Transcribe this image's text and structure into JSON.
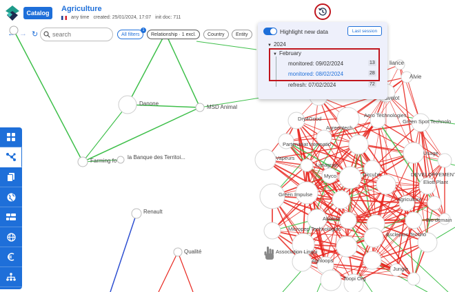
{
  "header": {
    "catalog_label": "Catalog",
    "title": "Agriculture",
    "period": "any time",
    "created": "created: 25/01/2024, 17:07",
    "init_doc": "init doc: 711"
  },
  "toolbar": {
    "search_placeholder": "search",
    "filters": {
      "all_filters": "All filters",
      "all_filters_badge": "1",
      "relationship": "Relationship · 1 excl.",
      "country": "Country",
      "entity": "Entity"
    }
  },
  "session_panel": {
    "highlight_label": "Highlight new data",
    "highlight_on": true,
    "last_session_label": "Last session",
    "year": "2024",
    "month": "February",
    "entries": [
      {
        "label": "monitored: 09/02/2024",
        "count": "13",
        "active": false
      },
      {
        "label": "monitored: 08/02/2024",
        "count": "28",
        "active": true
      },
      {
        "label": "refresh: 07/02/2024",
        "count": "72",
        "active": false
      }
    ]
  },
  "sidebar": {
    "items": [
      {
        "icon": "grid-icon",
        "active": false
      },
      {
        "icon": "network-icon",
        "active": true
      },
      {
        "icon": "documents-icon",
        "active": false
      },
      {
        "icon": "globe-icon",
        "active": false
      },
      {
        "icon": "timeline-icon",
        "active": false
      },
      {
        "icon": "world-grid-icon",
        "active": false
      },
      {
        "icon": "euro-icon",
        "active": false
      },
      {
        "icon": "hierarchy-icon",
        "active": false
      }
    ]
  },
  "graph": {
    "labels": {
      "danone": "Danone",
      "msd": "MSD Animal",
      "farming": "Farming fo",
      "banque": "la Banque des Territoi...",
      "renault": "Renault",
      "qualite": "Qualité",
      "alliance": "liance",
      "alvie": "Alvie",
      "cavelot": "avelot",
      "dry4good": "Dry4Good",
      "agreen": "Agreentech",
      "aero": "Aero Technologies",
      "greenspot": "Green Spot Technolo",
      "partenariat": "Partenariat Internatio",
      "vapeurs": "Vapeurs",
      "limagrain": "Limagrain",
      "myco": "Myco",
      "circul": "Circul'e",
      "usage": "Usage",
      "developpement": "DEVELOPPEMENT",
      "eliott": "Eliott Plant",
      "greenimpulse": "Green Impulse",
      "agriculture": "Agriculture",
      "akiama": "Akiama",
      "micropep": "Micropep Technologies",
      "biodemain": "Bio demain",
      "asclepios": "Asclepios Techno",
      "association": "Association Lingui",
      "agriloops": "Agriloops",
      "jungle": "Jungle",
      "toopi": "Toopi Org"
    }
  },
  "colors": {
    "accent": "#1e6fd9",
    "highlight_ring": "#c0141c",
    "edge_red": "#e8261e",
    "edge_green": "#3ebf4a",
    "edge_blue": "#2e4fd1"
  }
}
